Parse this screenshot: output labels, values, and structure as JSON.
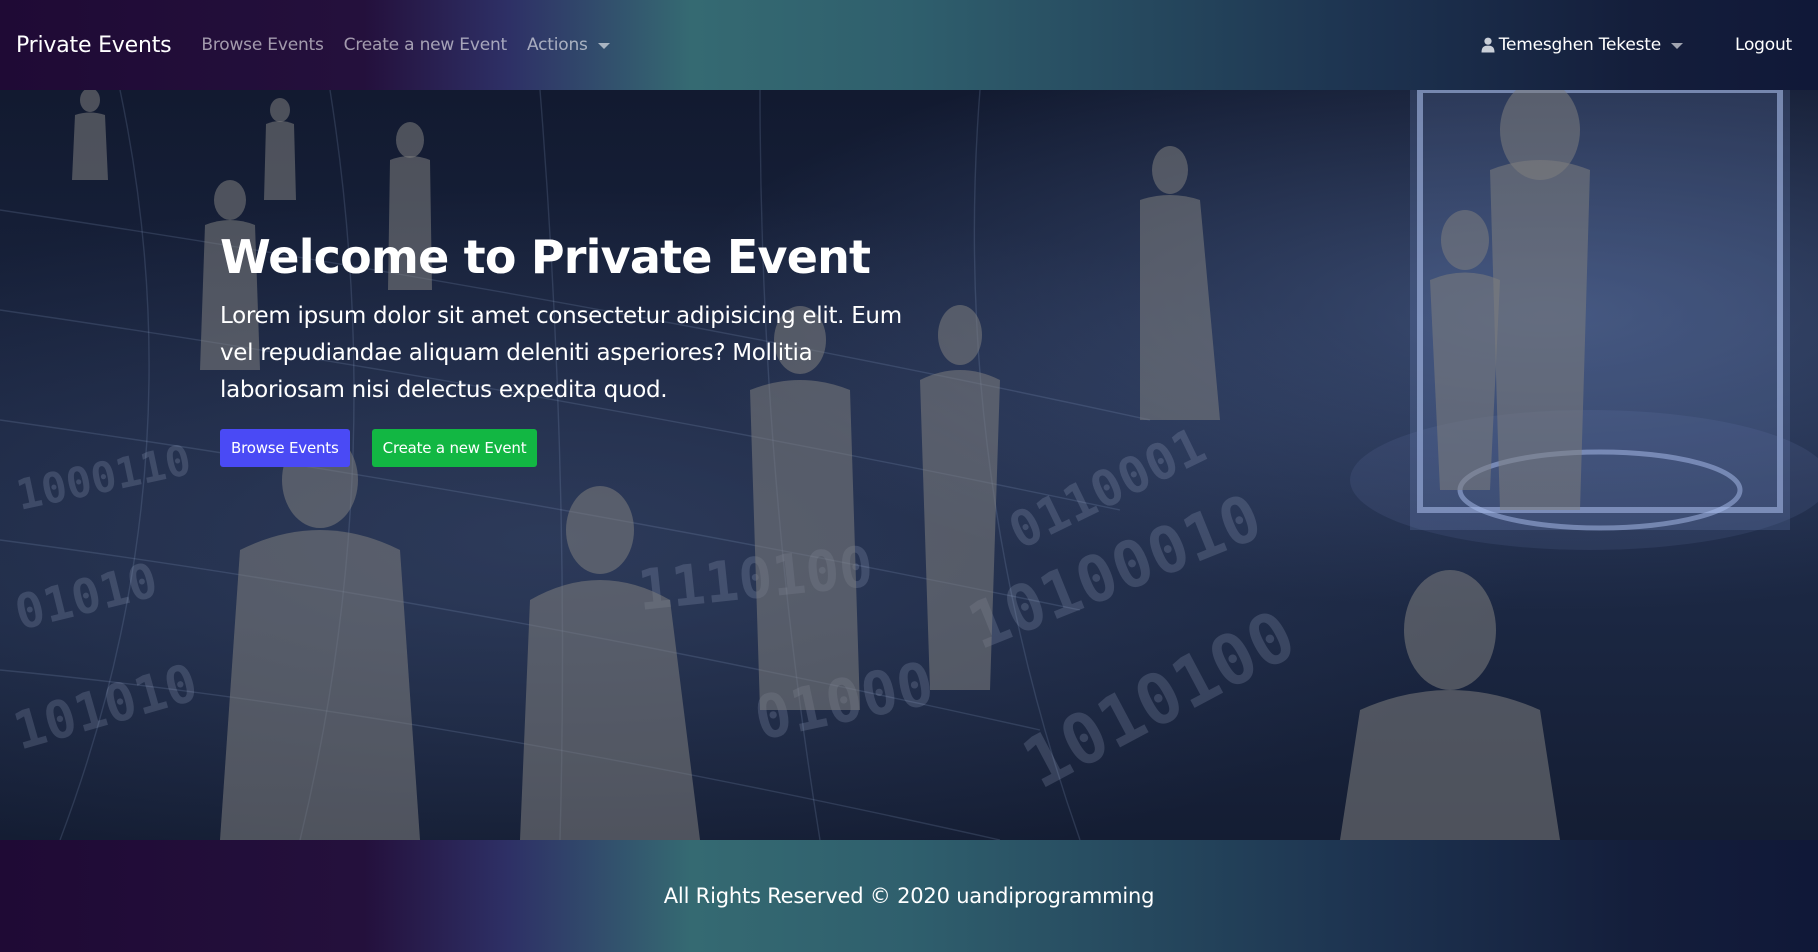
{
  "navbar": {
    "brand": "Private Events",
    "links": [
      {
        "label": "Browse Events"
      },
      {
        "label": "Create a new Event"
      }
    ],
    "actions_label": "Actions",
    "user_name": "Temesghen Tekeste",
    "logout_label": "Logout"
  },
  "hero": {
    "title": "Welcome to Private Event",
    "text": "Lorem ipsum dolor sit amet consectetur adipisicing elit. Eum vel repudiandae aliquam deleniti asperiores? Mollitia laboriosam nisi delectus expedita quod.",
    "buttons": {
      "browse": "Browse Events",
      "create": "Create a new Event"
    }
  },
  "footer": {
    "text": "All Rights Reserved © 2020 uandiprogramming"
  },
  "colors": {
    "primary_button": "#4a4af5",
    "success_button": "#12b743",
    "nav_gradient_start": "#1f0a35",
    "nav_gradient_mid": "#356a72",
    "nav_gradient_end": "#101838"
  },
  "icons": {
    "user": "user-icon",
    "dropdown": "caret-down-icon"
  }
}
